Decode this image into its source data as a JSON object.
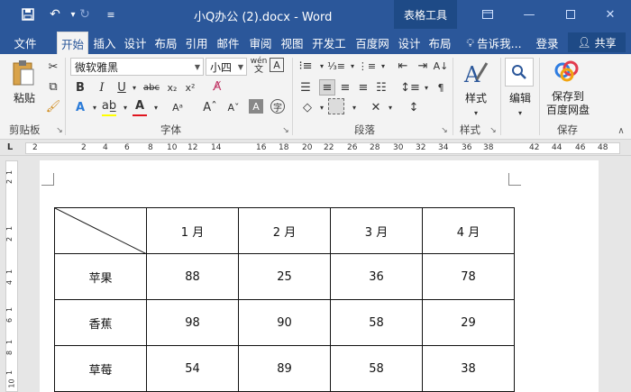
{
  "titlebar": {
    "doc_title": "小Q办公 (2).docx - Word",
    "context_tab": "表格工具",
    "icons": [
      "save-icon",
      "undo-icon",
      "redo-icon",
      "customize-qa-icon"
    ],
    "accent": "#2b579a"
  },
  "tabs": [
    "文件",
    "开始",
    "插入",
    "设计",
    "布局",
    "引用",
    "邮件",
    "审阅",
    "视图",
    "开发工",
    "百度网",
    "设计",
    "布局"
  ],
  "active_tab": "开始",
  "tell_me": "告诉我...",
  "login": "登录",
  "share": "共享",
  "ribbon": {
    "clipboard": {
      "paste": "粘贴",
      "label": "剪贴板"
    },
    "font": {
      "name": "微软雅黑",
      "size": "小四",
      "label": "字体",
      "bold": "B",
      "italic": "I",
      "underline": "U",
      "strike": "abc",
      "sub": "x₂",
      "sup": "x²",
      "wen": "wén"
    },
    "paragraph": {
      "label": "段落"
    },
    "styles": {
      "button": "样式",
      "label": "样式"
    },
    "edit": {
      "button": "编辑"
    },
    "save": {
      "button_line1": "保存到",
      "button_line2": "百度网盘",
      "label": "保存"
    }
  },
  "ruler": {
    "numbers": [
      "2",
      "2",
      "4",
      "6",
      "8",
      "10",
      "12",
      "14",
      "16",
      "18",
      "20",
      "22",
      "26",
      "28",
      "30",
      "32",
      "34",
      "36",
      "38",
      "42",
      "44",
      "46",
      "48"
    ],
    "vnumbers": [
      "1",
      "2",
      "1",
      "2",
      "1",
      "4",
      "1",
      "6",
      "1",
      "8",
      "1",
      "10"
    ]
  },
  "table": {
    "header": [
      "",
      "1 月",
      "2 月",
      "3 月",
      "4 月"
    ],
    "rows": [
      {
        "label": "苹果",
        "values": [
          "88",
          "25",
          "36",
          "78"
        ]
      },
      {
        "label": "香蕉",
        "values": [
          "98",
          "90",
          "58",
          "29"
        ]
      },
      {
        "label": "草莓",
        "values": [
          "54",
          "89",
          "58",
          "38"
        ]
      }
    ]
  }
}
